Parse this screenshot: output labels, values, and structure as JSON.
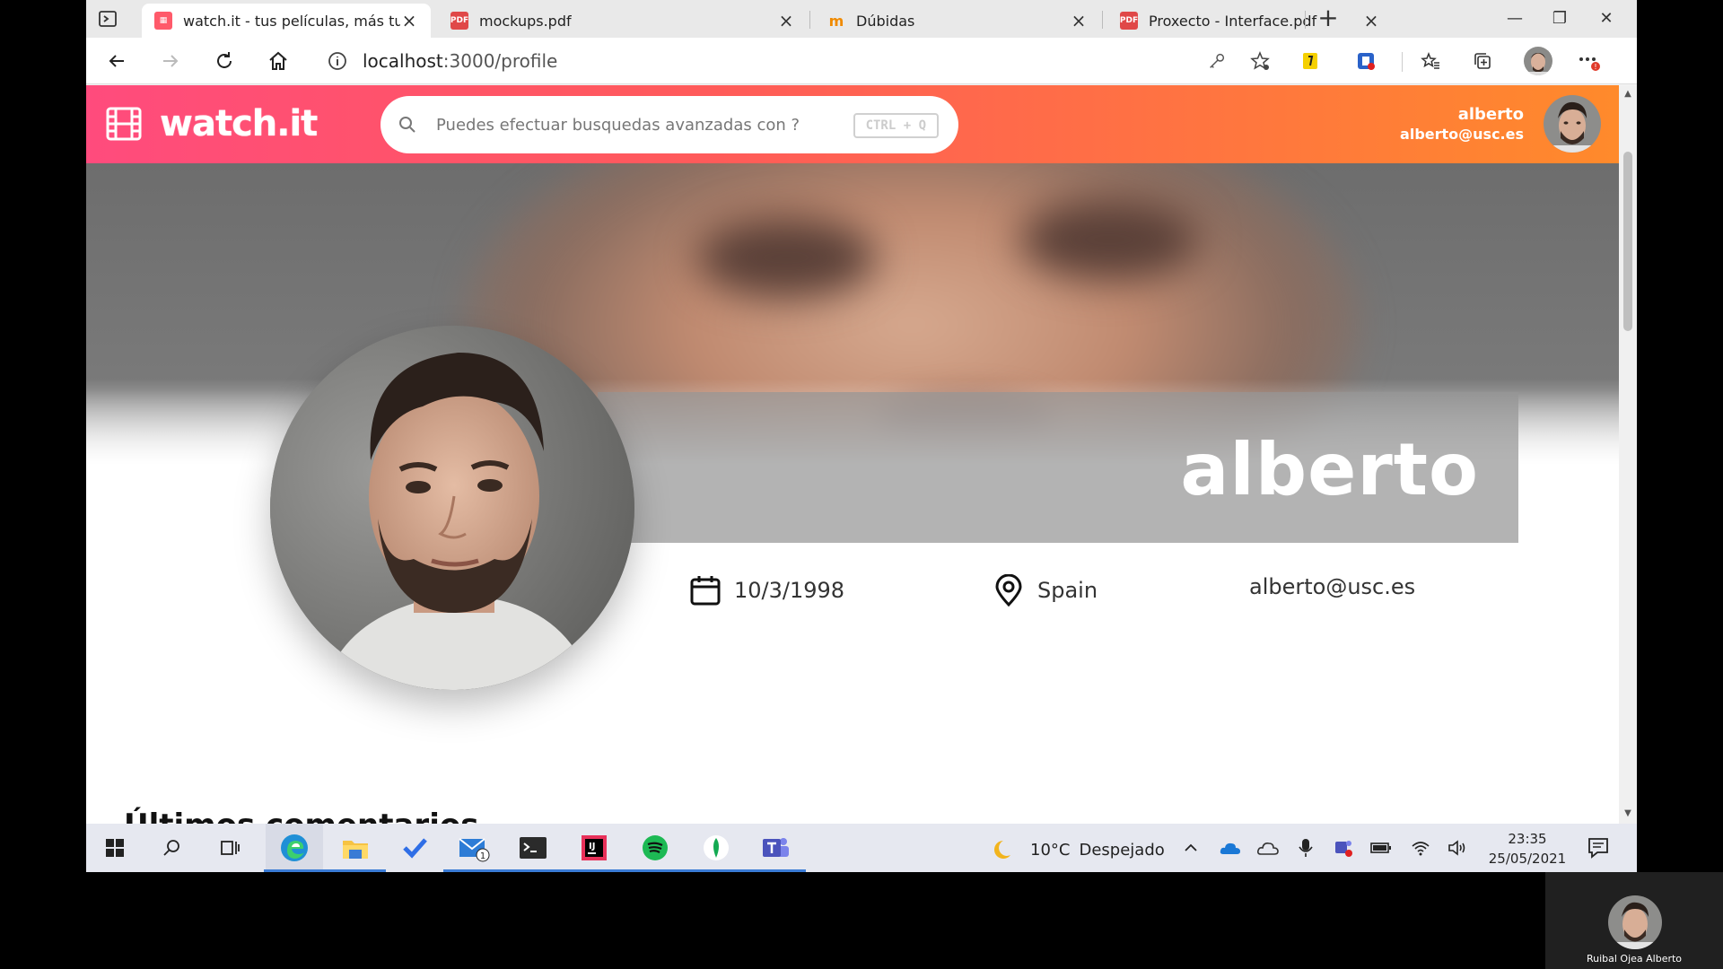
{
  "browser": {
    "tabs": [
      {
        "title": "watch.it - tus películas, más tuyas",
        "icon": "watchit-favicon",
        "active": true
      },
      {
        "title": "mockups.pdf",
        "icon": "pdf-icon",
        "active": false
      },
      {
        "title": "Dúbidas",
        "icon": "moodle-icon",
        "active": false
      },
      {
        "title": "Proxecto - Interface.pdf",
        "icon": "pdf-icon",
        "active": false
      }
    ],
    "url_host": "localhost",
    "url_path": ":3000/profile"
  },
  "app": {
    "logo_text": "watch.it",
    "search_placeholder": "Puedes efectuar busquedas avanzadas con ?",
    "search_shortcut": "CTRL + Q",
    "user_name": "alberto",
    "user_email": "alberto@usc.es"
  },
  "profile": {
    "name": "alberto",
    "birthdate": "10/3/1998",
    "country": "Spain",
    "email": "alberto@usc.es",
    "section_title": "Últimos comentarios"
  },
  "taskbar": {
    "weather_temp": "10°C",
    "weather_desc": "Despejado",
    "time": "23:35",
    "date": "25/05/2021",
    "mail_badge": "1"
  },
  "call": {
    "participant_name": "Ruibal Ojea Alberto"
  },
  "colors": {
    "header_start": "#ff4b7d",
    "header_end": "#ff8a2b",
    "edge_accent": "#3a7bd5"
  }
}
